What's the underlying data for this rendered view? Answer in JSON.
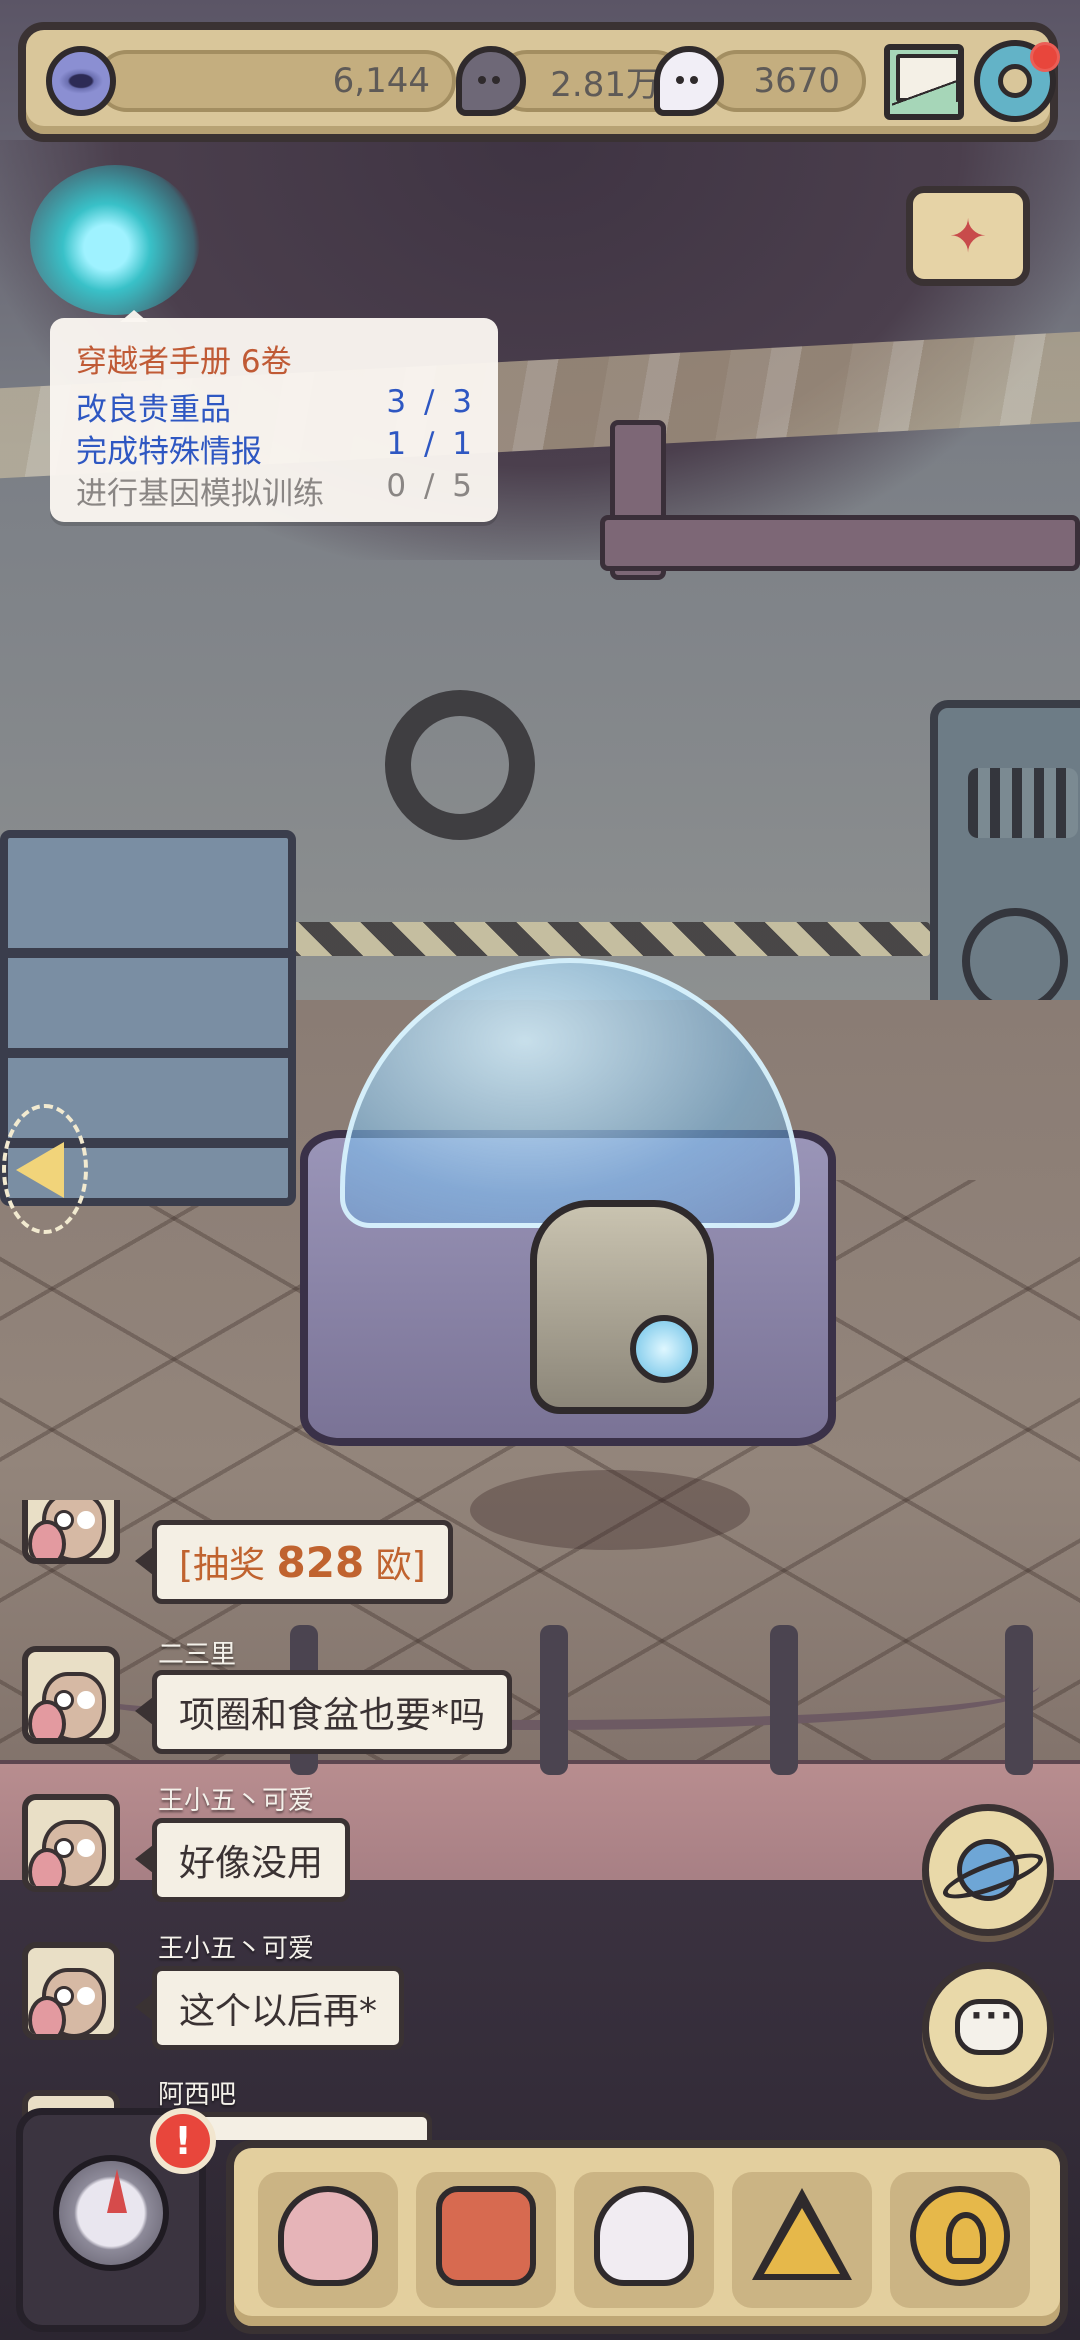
{
  "hud": {
    "eye_currency": "6,144",
    "bubble_currency": "2.81万",
    "chat_currency": "3670"
  },
  "quest": {
    "title": "穿越者手册  6卷",
    "tasks": [
      {
        "label": "改良贵重品",
        "progress": "3 / 3",
        "done": true
      },
      {
        "label": "完成特殊情报",
        "progress": "1 / 1",
        "done": true
      },
      {
        "label": "进行基因模拟训练",
        "progress": "0 / 5",
        "done": false
      }
    ]
  },
  "chat": {
    "messages": [
      {
        "name": "",
        "prefix": "[抽奖 ",
        "amount": "828",
        "suffix": " 欧]"
      },
      {
        "name": "二三里",
        "text": "项圈和食盆也要*吗"
      },
      {
        "name": "王小五丶可爱",
        "text": "好像没用"
      },
      {
        "name": "王小五丶可爱",
        "text": "这个以后再*"
      },
      {
        "name": "阿西吧",
        "text": ""
      }
    ]
  },
  "badges": {
    "alert": "!"
  },
  "icons": {
    "top_left": "eye-icon",
    "currency_2": "dark-bubble-icon",
    "currency_3": "light-bubble-icon",
    "mail": "mail-icon",
    "settings": "gear-icon",
    "event": "party-popper-icon",
    "planet": "planet-icon",
    "chat": "chat-bubble-icon",
    "compass": "compass-icon",
    "dock": [
      "snail-icon",
      "backpack-icon",
      "bust-statue-icon",
      "pyramid-eye-icon",
      "coin-key-icon"
    ]
  },
  "colors": {
    "quest_done": "#2e57c2",
    "quest_todo": "#8a8684",
    "quest_title": "#c05a35",
    "alert": "#e8463c"
  }
}
